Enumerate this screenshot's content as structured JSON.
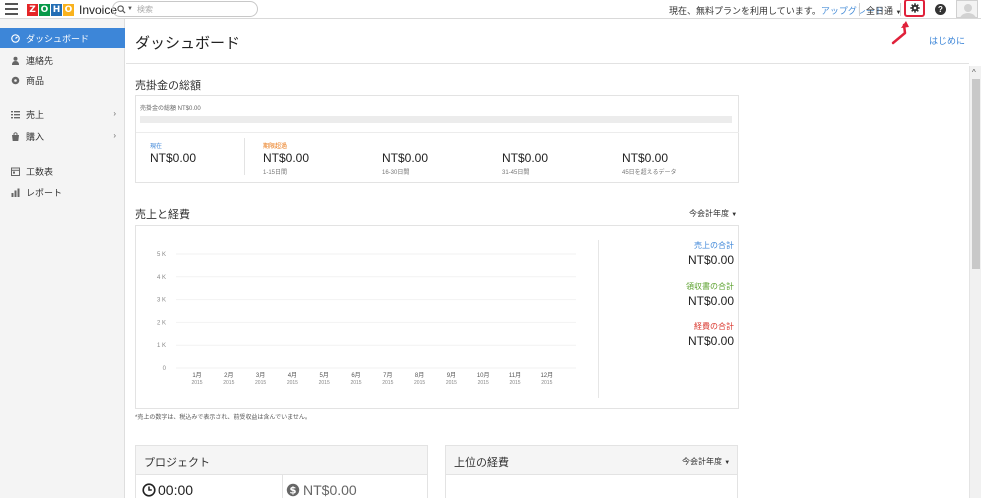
{
  "app": {
    "logo_letters": [
      {
        "ch": "Z",
        "color": "#e42527"
      },
      {
        "ch": "O",
        "color": "#089949"
      },
      {
        "ch": "H",
        "color": "#226db4"
      },
      {
        "ch": "O",
        "color": "#f9b21d"
      }
    ],
    "product": "Invoice"
  },
  "search": {
    "placeholder": "検索"
  },
  "topbar": {
    "plan_text": "現在、無料プランを利用しています。",
    "upgrade_link": "アップグレード",
    "org_name": "全日通"
  },
  "sidebar": {
    "items": [
      {
        "label": "ダッシュボード",
        "icon": "dashboard-icon",
        "active": true,
        "has_submenu": false
      },
      {
        "label": "連絡先",
        "icon": "contacts-icon",
        "active": false,
        "has_submenu": false
      },
      {
        "label": "商品",
        "icon": "items-icon",
        "active": false,
        "has_submenu": false
      },
      {
        "label": "売上",
        "icon": "sales-icon",
        "active": false,
        "has_submenu": true
      },
      {
        "label": "購入",
        "icon": "purchases-icon",
        "active": false,
        "has_submenu": true
      },
      {
        "label": "工数表",
        "icon": "timesheet-icon",
        "active": false,
        "has_submenu": false
      },
      {
        "label": "レポート",
        "icon": "reports-icon",
        "active": false,
        "has_submenu": false
      }
    ]
  },
  "page": {
    "title": "ダッシュボード",
    "get_started": "はじめに"
  },
  "receivables": {
    "title": "売掛金の総額",
    "total_label": "売掛金の総額 NT$0.00",
    "buckets": [
      {
        "label": "現在",
        "amount": "NT$0.00",
        "sub": "",
        "label_color": "#3d86d8"
      },
      {
        "label": "期限超過",
        "amount": "NT$0.00",
        "sub": "1-15日間",
        "label_color": "#e8710a"
      },
      {
        "label": "",
        "amount": "NT$0.00",
        "sub": "16-30日間",
        "label_color": "#333333"
      },
      {
        "label": "",
        "amount": "NT$0.00",
        "sub": "31-45日間",
        "label_color": "#333333"
      },
      {
        "label": "",
        "amount": "NT$0.00",
        "sub": "45日を超えるデータ",
        "label_color": "#333333"
      }
    ]
  },
  "sales_expenses": {
    "title": "売上と経費",
    "period": "今会計年度",
    "summary": [
      {
        "label": "売上の合計",
        "amount": "NT$0.00",
        "color": "#3d86d8"
      },
      {
        "label": "領収書の合計",
        "amount": "NT$0.00",
        "color": "#5aa02c"
      },
      {
        "label": "経費の合計",
        "amount": "NT$0.00",
        "color": "#d9342b"
      }
    ],
    "footnote": "*売上の数字は、税込みで表示され、前受収益は含んでいません。"
  },
  "chart_data": {
    "type": "bar",
    "title": "",
    "categories": [
      "1月 2015",
      "2月 2015",
      "3月 2015",
      "4月 2015",
      "5月 2015",
      "6月 2015",
      "7月 2015",
      "8月 2015",
      "9月 2015",
      "10月 2015",
      "11月 2015",
      "12月 2015"
    ],
    "category_labels": [
      {
        "month": "1月",
        "year": "2015"
      },
      {
        "month": "2月",
        "year": "2015"
      },
      {
        "month": "3月",
        "year": "2015"
      },
      {
        "month": "4月",
        "year": "2015"
      },
      {
        "month": "5月",
        "year": "2015"
      },
      {
        "month": "6月",
        "year": "2015"
      },
      {
        "month": "7月",
        "year": "2015"
      },
      {
        "month": "8月",
        "year": "2015"
      },
      {
        "month": "9月",
        "year": "2015"
      },
      {
        "month": "10月",
        "year": "2015"
      },
      {
        "month": "11月",
        "year": "2015"
      },
      {
        "month": "12月",
        "year": "2015"
      }
    ],
    "series": [
      {
        "name": "売上の合計",
        "values": [
          0,
          0,
          0,
          0,
          0,
          0,
          0,
          0,
          0,
          0,
          0,
          0
        ]
      },
      {
        "name": "領収書の合計",
        "values": [
          0,
          0,
          0,
          0,
          0,
          0,
          0,
          0,
          0,
          0,
          0,
          0
        ]
      },
      {
        "name": "経費の合計",
        "values": [
          0,
          0,
          0,
          0,
          0,
          0,
          0,
          0,
          0,
          0,
          0,
          0
        ]
      }
    ],
    "y_ticks": [
      0,
      1000,
      2000,
      3000,
      4000,
      5000
    ],
    "y_tick_labels": [
      "0",
      "1 K",
      "2 K",
      "3 K",
      "4 K",
      "5 K"
    ],
    "ylim": [
      0,
      5000
    ],
    "xlabel": "",
    "ylabel": "",
    "grid": true
  },
  "projects": {
    "title": "プロジェクト",
    "time": "00:00",
    "amount": "NT$0.00"
  },
  "top_expenses": {
    "title": "上位の経費",
    "period": "今会計年度"
  },
  "colors": {
    "accent": "#3d86d8",
    "highlight": "#e0213a"
  }
}
